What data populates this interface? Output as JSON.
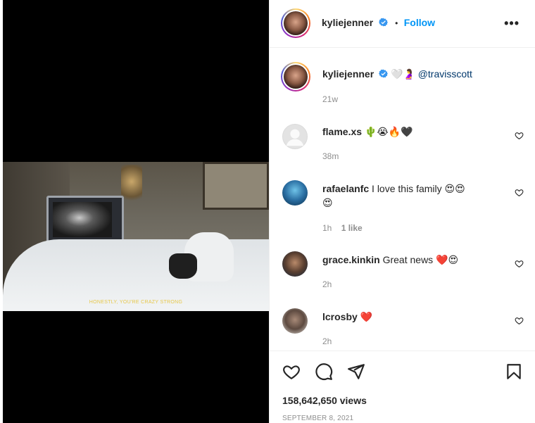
{
  "post": {
    "author": "kyliejenner",
    "follow_label": "Follow",
    "dot": "•",
    "more": "•••",
    "video_caption": "HONESTLY, YOU'RE CRAZY STRONG"
  },
  "caption": {
    "author": "kyliejenner",
    "text": "🤍🤰",
    "mention": "@travisscott",
    "time": "21w"
  },
  "comments": [
    {
      "user": "flame.xs",
      "text": "🌵😭🔥🖤",
      "time": "38m",
      "likes": ""
    },
    {
      "user": "rafaelanfc",
      "text": "I love this family 😍😍",
      "text2": "😍",
      "time": "1h",
      "likes": "1 like"
    },
    {
      "user": "grace.kinkin",
      "text": "Great news ❤️😍",
      "time": "2h",
      "likes": ""
    },
    {
      "user": "lcrosby",
      "text": "❤️",
      "time": "2h",
      "likes": ""
    }
  ],
  "stats": {
    "views": "158,642,650 views",
    "date": "SEPTEMBER 8, 2021"
  },
  "colors": {
    "accent": "#0095f6",
    "verified": "#3897f0",
    "mention": "#00376b",
    "secondary_text": "#8e8e8e"
  },
  "icons": [
    "verified-icon",
    "more-icon",
    "heart-icon",
    "comment-icon",
    "share-icon",
    "bookmark-icon"
  ]
}
